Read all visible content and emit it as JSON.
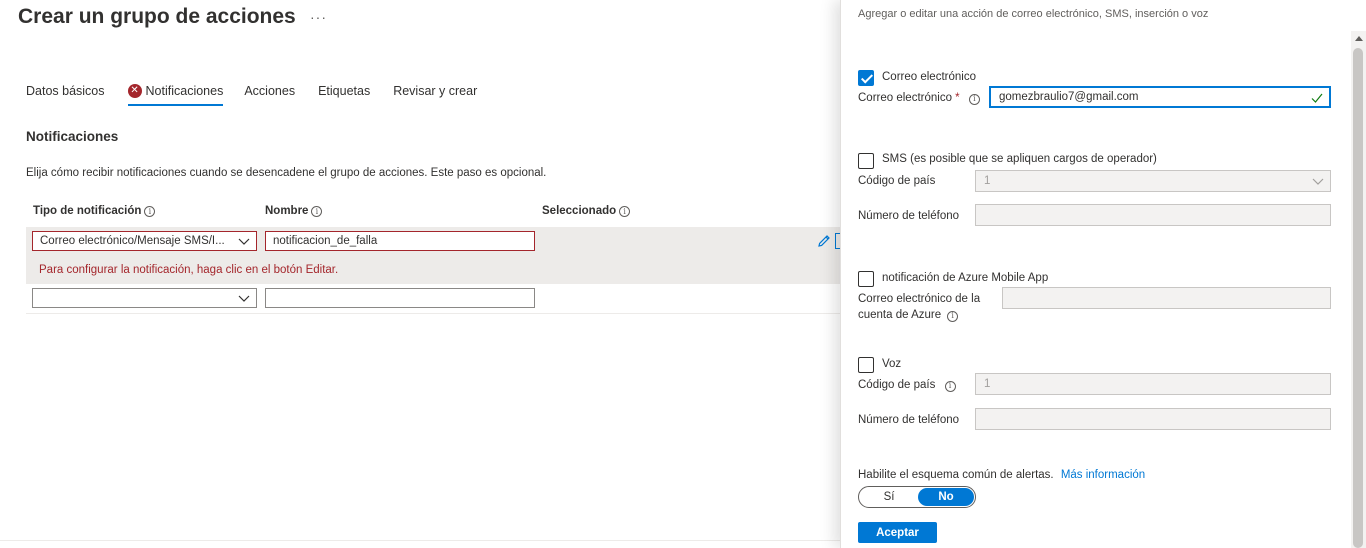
{
  "page": {
    "title": "Crear un grupo de acciones",
    "more": "···"
  },
  "tabs": [
    {
      "label": "Datos básicos"
    },
    {
      "label": "Notificaciones",
      "error": true,
      "active": true
    },
    {
      "label": "Acciones"
    },
    {
      "label": "Etiquetas"
    },
    {
      "label": "Revisar y crear"
    }
  ],
  "notifications": {
    "title": "Notificaciones",
    "description": "Elija cómo recibir notificaciones cuando se desencadene el grupo de acciones. Este paso es opcional.",
    "columns": {
      "type": "Tipo de notificación",
      "name": "Nombre",
      "selected": "Seleccionado"
    },
    "rows": [
      {
        "type": "Correo electrónico/Mensaje SMS/I...",
        "name": "notificacion_de_falla",
        "error": "Para configurar la notificación, haga clic en el botón Editar."
      },
      {
        "type": "",
        "name": ""
      }
    ]
  },
  "panel": {
    "subtitle": "Agregar o editar una acción de correo electrónico, SMS, inserción o voz",
    "email": {
      "checkbox_label": "Correo electrónico",
      "checked": true,
      "field_label": "Correo electrónico",
      "required_mark": "*",
      "value": "gomezbraulio7@gmail.com"
    },
    "sms": {
      "checkbox_label": "SMS (es posible que se apliquen cargos de operador)",
      "checked": false,
      "country_label": "Código de país",
      "country_value": "1",
      "phone_label": "Número de teléfono",
      "phone_value": ""
    },
    "push": {
      "checkbox_label": "notificación de Azure Mobile App",
      "checked": false,
      "account_label_line1": "Correo electrónico de la",
      "account_label_line2": "cuenta de Azure",
      "account_value": ""
    },
    "voice": {
      "checkbox_label": "Voz",
      "checked": false,
      "country_label": "Código de país",
      "country_value": "1",
      "phone_label": "Número de teléfono",
      "phone_value": ""
    },
    "common_schema": {
      "label": "Habilite el esquema común de alertas.",
      "link": "Más información",
      "option_yes": "Sí",
      "option_no": "No",
      "selected": "No"
    },
    "accept_label": "Aceptar"
  },
  "colors": {
    "accent": "#0078d4",
    "error": "#a4262c"
  }
}
